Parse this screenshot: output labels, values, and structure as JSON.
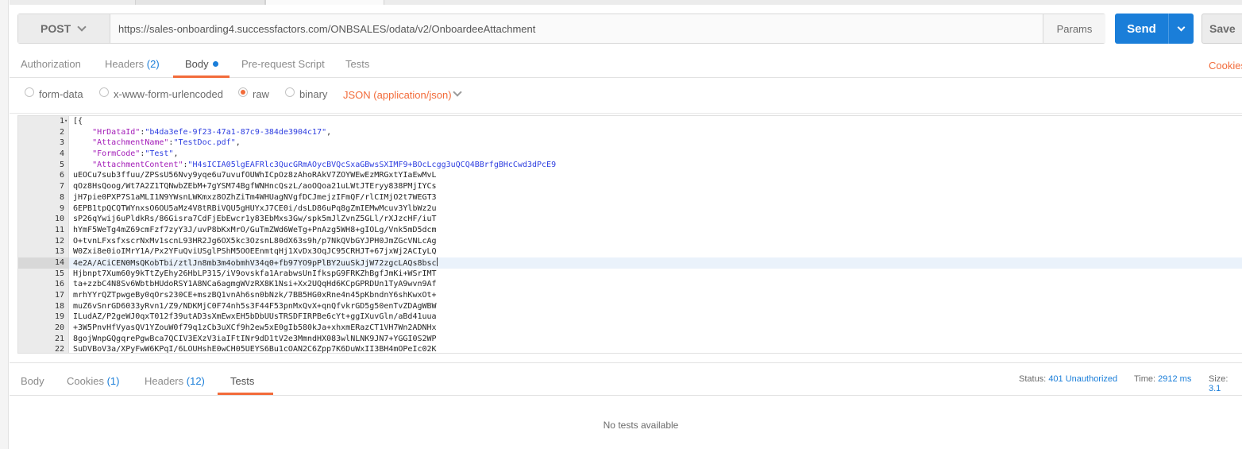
{
  "request": {
    "method": "POST",
    "url": "https://sales-onboarding4.successfactors.com/ONBSALES/odata/v2/OnboardeeAttachment",
    "params_label": "Params",
    "send_label": "Send",
    "save_label": "Save"
  },
  "request_tabs": [
    {
      "label": "Authorization",
      "count": ""
    },
    {
      "label": "Headers",
      "count": "(2)"
    },
    {
      "label": "Body",
      "count": ""
    },
    {
      "label": "Pre-request Script",
      "count": ""
    },
    {
      "label": "Tests",
      "count": ""
    }
  ],
  "cookies_label": "Cookies",
  "body_types": [
    {
      "label": "form-data",
      "selected": false
    },
    {
      "label": "x-www-form-urlencoded",
      "selected": false
    },
    {
      "label": "raw",
      "selected": true
    },
    {
      "label": "binary",
      "selected": false
    }
  ],
  "content_type": "JSON (application/json)",
  "editor": {
    "lines": [
      {
        "n": "1",
        "text": "[{"
      },
      {
        "n": "2",
        "key": "\"HrDataId\"",
        "value": "\"b4da3efe-9f23-47a1-87c9-384de3904c17\"",
        "tail": ","
      },
      {
        "n": "3",
        "key": "\"AttachmentName\"",
        "value": "\"TestDoc.pdf\"",
        "tail": ","
      },
      {
        "n": "4",
        "key": "\"FormCode\"",
        "value": "\"Test\"",
        "tail": ","
      },
      {
        "n": "5",
        "key": "\"AttachmentContent\"",
        "value": "\"H4sICIA05lgEAFRlc3QucGRmAOycBVQcSxaGBwsSXIMF9+BOcLcgg3uQCQ4BBrfgBHcCwd3dPcE9",
        "tail": ""
      },
      {
        "n": "6",
        "text": "uEOCu7sub3ffuu/ZPSsU56Nvy9yqe6u7uvufOUWhICpOz8zAhoRAkV7ZOYWEwEzMRGxtYIaEwMvL"
      },
      {
        "n": "7",
        "text": "qOz8HsQoog/Wt7A2Z1TQNwbZEbM+7gYSM74BgfWNHncQszL/aoOQoa21uLWtJTEryy838PMjIYCs"
      },
      {
        "n": "8",
        "text": "jH7pie0PXP7S1aMLI1N9YWsnLWKmxz8OZhZiTm4WHUagNVgfDCJmejzIFmQF/rlCIMjO2t7WEGT3"
      },
      {
        "n": "9",
        "text": "6EPB1tpQCQTWYnxsO6OU5aMz4V8tRBiVQU5gHUYxJ7CE0i/dsLD86uPq8gZmIEMwMcuv3YlbWz2u"
      },
      {
        "n": "10",
        "text": "sP26qYwij6uPldkRs/86Gisra7CdFjEbEwcr1y83EbMxs3Gw/spk5mJlZvnZ5GLl/rXJzcHF/iuT"
      },
      {
        "n": "11",
        "text": "hYmF5WeTg4mZ69cmFzf7zyY3J/uvP8bKxMrO/GuTmZWd6WeTg+PnAzg5WH8+gIOLg/Vnk5mD5dcm"
      },
      {
        "n": "12",
        "text": "O+tvnLFxsfxscrNxMv1scnL93HR2Jg6OX5kc3OzsnL80dX63s9h/p7NkQVbGYJPH0JmZGcVNLcAg"
      },
      {
        "n": "13",
        "text": "W0Zxi8e0ioIMrY1A/Px2YFuQviUSglPShM5OOEEnmtqHj1XvDx3OqJC95CRHJT+67jxWj2ACIyLQ"
      },
      {
        "n": "14",
        "text": "4e2A/ACiCEN0MsQKobTbi/ztlJn8mb3m4obmhV34q0+fb97YO9pPlBY2uuSkJjW72zgcLAQs8bsc",
        "highlight": true
      },
      {
        "n": "15",
        "text": "Hjbnpt7Xum60y9kTtZyEhy26HbLP315/iV9ovskfa1ArabwsUnIfkspG9FRKZhBgfJmKi+WSrIMT"
      },
      {
        "n": "16",
        "text": "ta+zzbC4N8Sv6WbtbHUdoRSY1A8NCa6agmgWVzRX8K1Nsi+Xx2UQqHd6KCpGPRDUn1TyA9wvn9Af"
      },
      {
        "n": "17",
        "text": "mrhYYrQZTpwgeBy0qOrs230CE+mszBQ1vnAh6sn0bNzk/7BB5HG0xRne4n45pKbndnY6shKwxOt+"
      },
      {
        "n": "18",
        "text": "muZ6vSnrGD6033yRvn1/Z9/NDKMjC0F74nh5s3F44F53pnMxQvX+qnQfvkrGD5g50enTvZDAgWBW"
      },
      {
        "n": "19",
        "text": "ILudAZ/P2geWJ0qxT012f39utAD3sXmEwxEH5bDbUUsTRSDFIRPBe6cYt+ggIXuvGln/aBd41uua"
      },
      {
        "n": "20",
        "text": "+3W5PnvHfVyasQV1YZouW0f79q1zCb3uXCf9h2ew5xE0gIb580kJa+xhxmERazCT1VH7Wn2ADNHx"
      },
      {
        "n": "21",
        "text": "8gojWnpGQgqrePgwBca7QCIV3EXzV3iaIFtINr9dD1tV2e3MmndHX083wlNLNK9JN7+YGGI0S2WP"
      },
      {
        "n": "22",
        "text": "SuDVBoV3a/XPyFwW6KPqI/6LOUHshE0wCH05UEYS6Bu1cOAN2C6Zpp7K6DuWxII3BH4mOPeIc02K"
      }
    ]
  },
  "response": {
    "tabs": [
      {
        "label": "Body",
        "count": ""
      },
      {
        "label": "Cookies",
        "count": "(1)"
      },
      {
        "label": "Headers",
        "count": "(12)"
      },
      {
        "label": "Tests",
        "count": ""
      }
    ],
    "status_label": "Status:",
    "status_value": "401 Unauthorized",
    "time_label": "Time:",
    "time_value": "2912 ms",
    "size_label": "Size:",
    "size_value": "3.1",
    "empty_message": "No tests available"
  }
}
